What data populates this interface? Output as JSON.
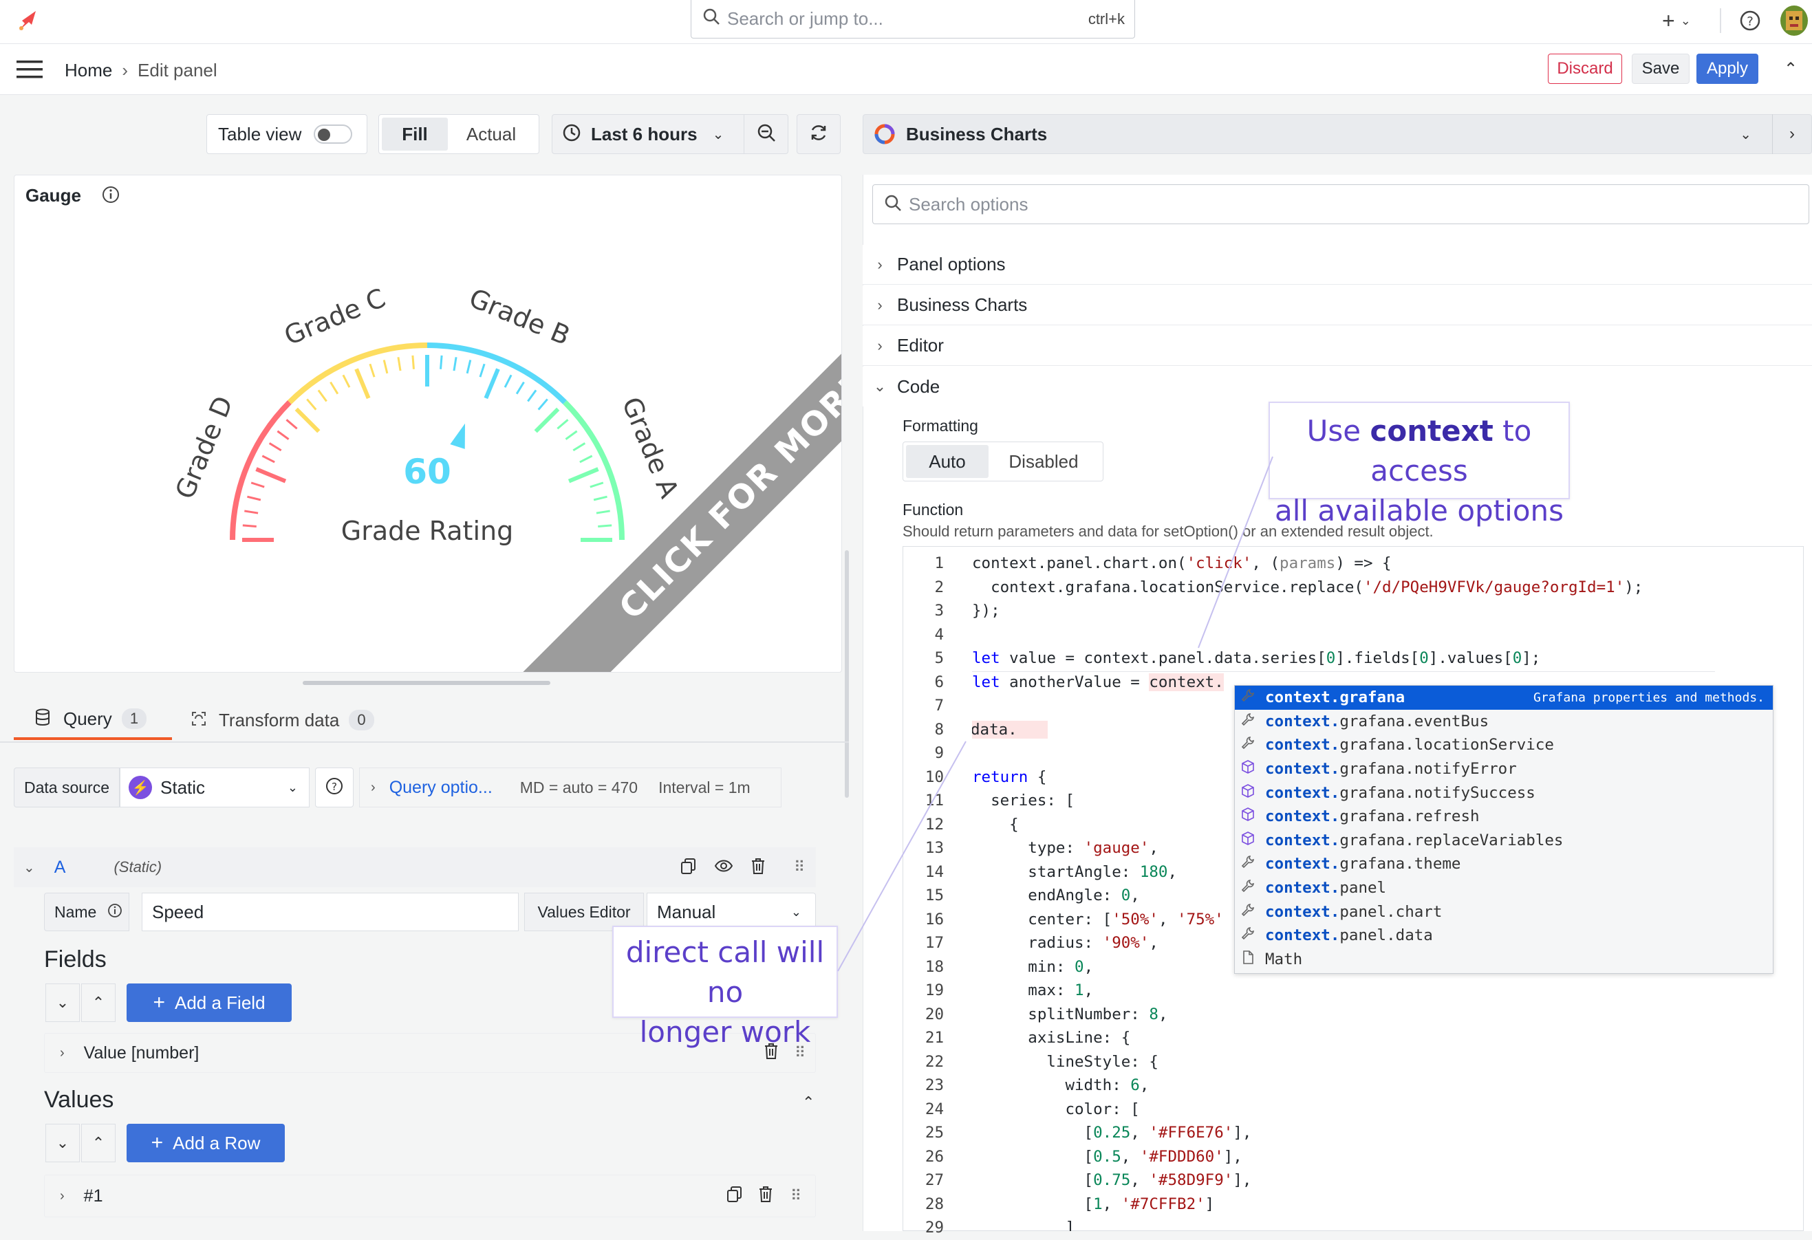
{
  "topbar": {
    "search_placeholder": "Search or jump to...",
    "search_shortcut": "ctrl+k",
    "plus_label": "+"
  },
  "breadcrumb": {
    "home": "Home",
    "separator": "›",
    "current": "Edit panel"
  },
  "actions": {
    "discard": "Discard",
    "save": "Save",
    "apply": "Apply"
  },
  "toolbar": {
    "table_view": "Table view",
    "fill": "Fill",
    "actual": "Actual",
    "time_range": "Last 6 hours"
  },
  "visualization": {
    "name": "Business Charts"
  },
  "panel": {
    "title": "Gauge",
    "gauge": {
      "value": 60,
      "label": "Grade Rating",
      "grades": [
        "Grade D",
        "Grade C",
        "Grade B",
        "Grade A"
      ],
      "min": 0,
      "max": 1,
      "colors": {
        "d": "#FF6E76",
        "c": "#FDDD60",
        "b": "#58D9F9",
        "a": "#7CFFB2"
      }
    },
    "banner": "CLICK FOR MORE"
  },
  "query_tabs": [
    {
      "label": "Query",
      "count": "1"
    },
    {
      "label": "Transform data",
      "count": "0"
    }
  ],
  "query": {
    "datasource_label": "Data source",
    "datasource_value": "Static",
    "query_options": "Query optio...",
    "md": "MD = auto = 470",
    "interval": "Interval = 1m",
    "ref_id": "A",
    "ref_type": "(Static)",
    "name_label": "Name",
    "name_value": "Speed",
    "values_editor_label": "Values Editor",
    "values_editor_value": "Manual",
    "fields_title": "Fields",
    "add_field": "Add a Field",
    "field_item": "Value [number]",
    "values_title": "Values",
    "add_row": "Add a Row",
    "row_item": "#1"
  },
  "options": {
    "search_placeholder": "Search options",
    "sections": [
      "Panel options",
      "Business Charts",
      "Editor",
      "Code"
    ],
    "formatting_label": "Formatting",
    "formatting_options": [
      "Auto",
      "Disabled"
    ],
    "function_label": "Function",
    "function_desc": "Should return parameters and data for setOption() or an extended result object."
  },
  "code": {
    "line_numbers": [
      "1",
      "2",
      "3",
      "4",
      "5",
      "6",
      "7",
      "8",
      "9",
      "10",
      "11",
      "12",
      "13",
      "14",
      "15",
      "16",
      "17",
      "18",
      "19",
      "20",
      "21",
      "22",
      "23",
      "24",
      "25",
      "26",
      "27",
      "28",
      "29"
    ]
  },
  "autocomplete": {
    "items": [
      {
        "prefix": "context.grafana",
        "rest": "",
        "icon": "wrench-icon"
      },
      {
        "prefix": "context.",
        "rest": "grafana.eventBus",
        "icon": "wrench-icon"
      },
      {
        "prefix": "context.",
        "rest": "grafana.locationService",
        "icon": "wrench-icon"
      },
      {
        "prefix": "context.",
        "rest": "grafana.notifyError",
        "icon": "cube-icon"
      },
      {
        "prefix": "context.",
        "rest": "grafana.notifySuccess",
        "icon": "cube-icon"
      },
      {
        "prefix": "context.",
        "rest": "grafana.refresh",
        "icon": "cube-icon"
      },
      {
        "prefix": "context.",
        "rest": "grafana.replaceVariables",
        "icon": "cube-icon"
      },
      {
        "prefix": "context.",
        "rest": "grafana.theme",
        "icon": "wrench-icon"
      },
      {
        "prefix": "context.",
        "rest": "panel",
        "icon": "wrench-icon"
      },
      {
        "prefix": "context.",
        "rest": "panel.chart",
        "icon": "wrench-icon"
      },
      {
        "prefix": "context.",
        "rest": "panel.data",
        "icon": "wrench-icon"
      },
      {
        "prefix": "",
        "rest": "Math",
        "icon": "file-icon"
      }
    ],
    "selected_detail": "Grafana properties and methods."
  },
  "callouts": {
    "top_line1_a": "Use ",
    "top_line1_b": "context",
    "top_line1_c": " to access",
    "top_line2": "all available options",
    "bottom_line1": "direct call will no",
    "bottom_line2": "longer work"
  }
}
